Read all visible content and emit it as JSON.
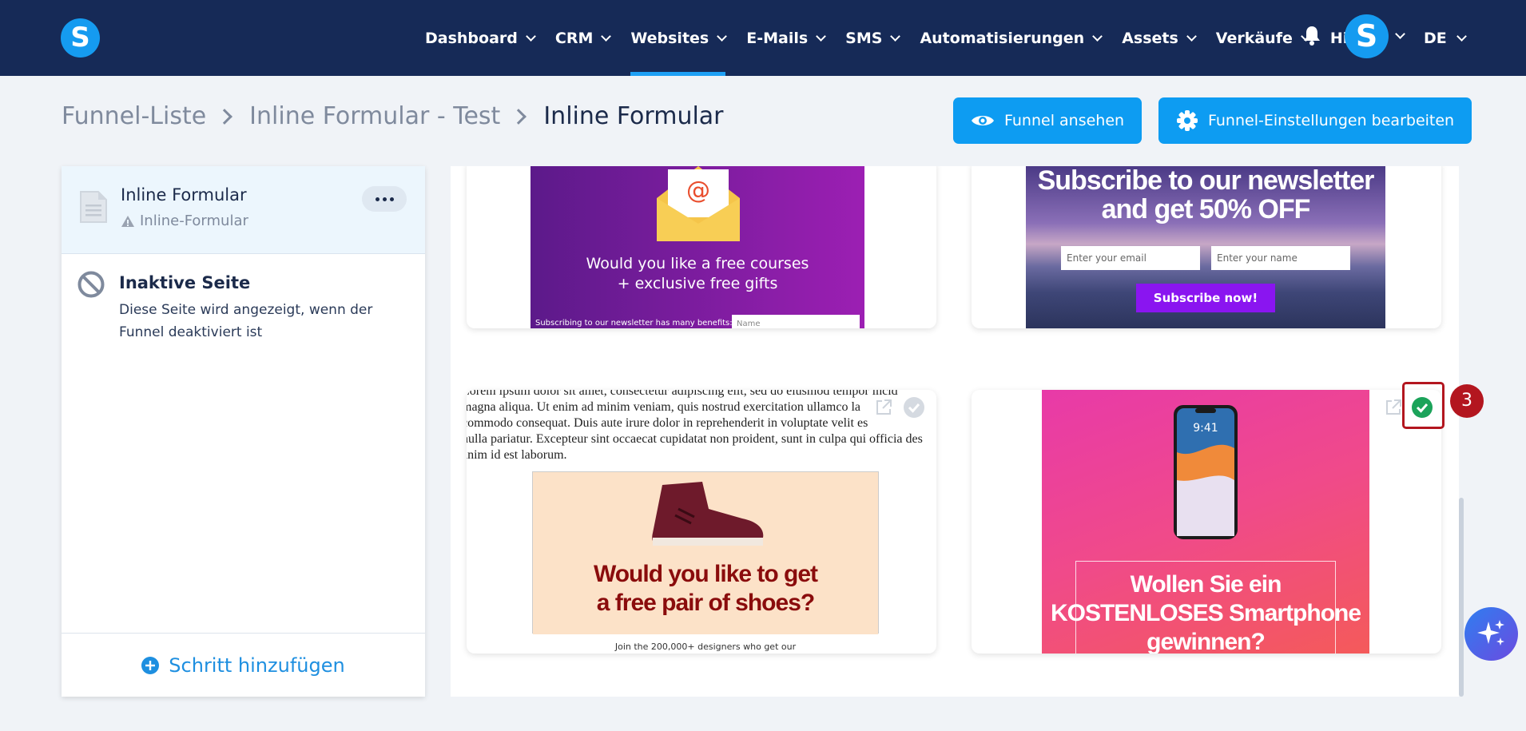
{
  "nav": {
    "items": [
      {
        "label": "Dashboard",
        "dropdown": true,
        "active": false
      },
      {
        "label": "CRM",
        "dropdown": true,
        "active": false
      },
      {
        "label": "Websites",
        "dropdown": true,
        "active": true
      },
      {
        "label": "E-Mails",
        "dropdown": true,
        "active": false
      },
      {
        "label": "SMS",
        "dropdown": true,
        "active": false
      },
      {
        "label": "Automatisierungen",
        "dropdown": true,
        "active": false
      },
      {
        "label": "Assets",
        "dropdown": true,
        "active": false
      },
      {
        "label": "Verkäufe",
        "dropdown": true,
        "active": false
      },
      {
        "label": "Hilfe",
        "dropdown": false,
        "active": false
      }
    ],
    "logo_letter": "S",
    "avatar_letter": "S",
    "language": "DE"
  },
  "breadcrumb": {
    "items": [
      "Funnel-Liste",
      "Inline Formular - Test",
      "Inline Formular"
    ]
  },
  "actions": {
    "view_funnel": "Funnel ansehen",
    "edit_settings": "Funnel-Einstellungen bearbeiten"
  },
  "steps": {
    "active": {
      "title": "Inline Formular",
      "subtitle": "Inline-Formular"
    },
    "inactive": {
      "title": "Inaktive Seite",
      "description": "Diese Seite wird angezeigt, wenn der Funnel deaktiviert ist"
    },
    "add_label": "Schritt hinzufügen"
  },
  "templates": {
    "free_courses": {
      "text_line1": "Would you like a free courses",
      "text_line2": "+ exclusive free gifts",
      "benefits": "Subscribing to our newsletter has many benefits:",
      "name_placeholder": "Name"
    },
    "newsletter": {
      "title_line1": "Subscribe to our newsletter",
      "title_line2": "and get 50% OFF",
      "email_placeholder": "Enter your email",
      "name_placeholder": "Enter your name",
      "button": "Subscribe now!"
    },
    "shoes": {
      "lorem_lines": [
        "Lorem ipsum dolor sit amet, consectetur adipiscing elit, sed do eiusmod tempor incid",
        "magna aliqua. Ut enim ad minim veniam, quis nostrud exercitation ullamco la",
        "commodo consequat. Duis aute irure dolor in reprehenderit in voluptate velit es",
        "nulla pariatur. Excepteur sint occaecat cupidatat non proident, sunt in culpa qui officia des",
        "anim id est laborum."
      ],
      "headline_line1": "Would you like to get",
      "headline_line2": "a free pair of shoes?",
      "small": "Join the 200,000+ designers who get our"
    },
    "smartphone": {
      "headline_line1": "Wollen Sie ein",
      "headline_line2": "KOSTENLOSES Smartphone",
      "headline_line3": "gewinnen?",
      "phone_time": "9:41"
    }
  },
  "annotation": {
    "step_number": "3"
  },
  "colors": {
    "nav_bg": "#162a57",
    "primary": "#0d9cf2",
    "success": "#1ba35a",
    "annotation": "#b3161f"
  }
}
